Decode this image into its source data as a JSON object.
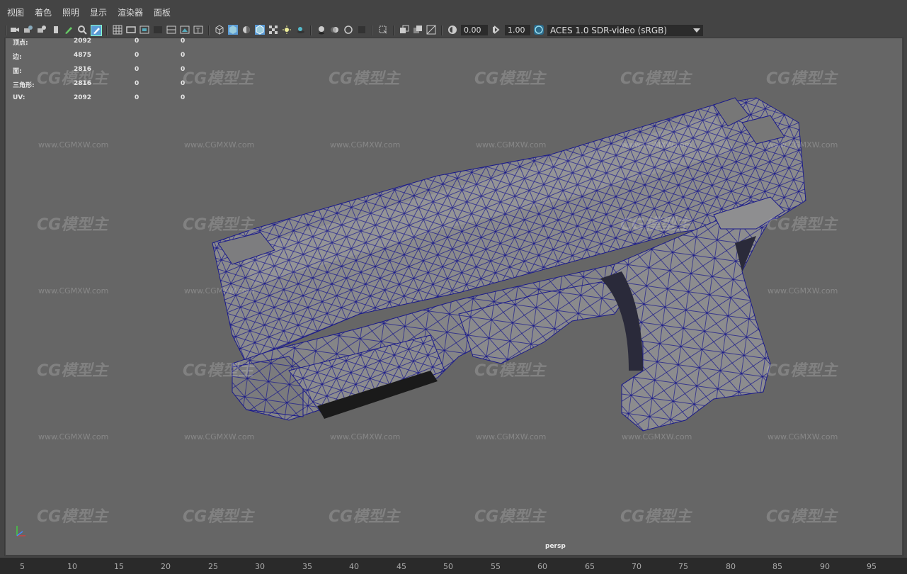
{
  "menu": [
    "视图",
    "着色",
    "照明",
    "显示",
    "渲染器",
    "面板"
  ],
  "toolbar": {
    "exposure_value": "0.00",
    "gamma_value": "1.00",
    "color_space": "ACES 1.0 SDR-video (sRGB)"
  },
  "hud": {
    "rows": [
      {
        "label": "顶点:",
        "v1": "2092",
        "v2": "0",
        "v3": "0"
      },
      {
        "label": "边:",
        "v1": "4875",
        "v2": "0",
        "v3": "0"
      },
      {
        "label": "面:",
        "v1": "2816",
        "v2": "0",
        "v3": "0"
      },
      {
        "label": "三角形:",
        "v1": "2816",
        "v2": "0",
        "v3": "0"
      },
      {
        "label": "UV:",
        "v1": "2092",
        "v2": "0",
        "v3": "0"
      }
    ]
  },
  "camera_label": "persp",
  "watermark": {
    "logo": "CG模型主",
    "url": "www.CGMXW.com"
  },
  "timeline": {
    "ticks": [
      "5",
      "10",
      "15",
      "20",
      "25",
      "30",
      "35",
      "40",
      "45",
      "50",
      "55",
      "60",
      "65",
      "70",
      "75",
      "80",
      "85",
      "90",
      "95"
    ]
  },
  "colors": {
    "wire": "#1a1a8a",
    "mesh_fill": "#8a8a8a",
    "viewport_bg": "#666666"
  }
}
